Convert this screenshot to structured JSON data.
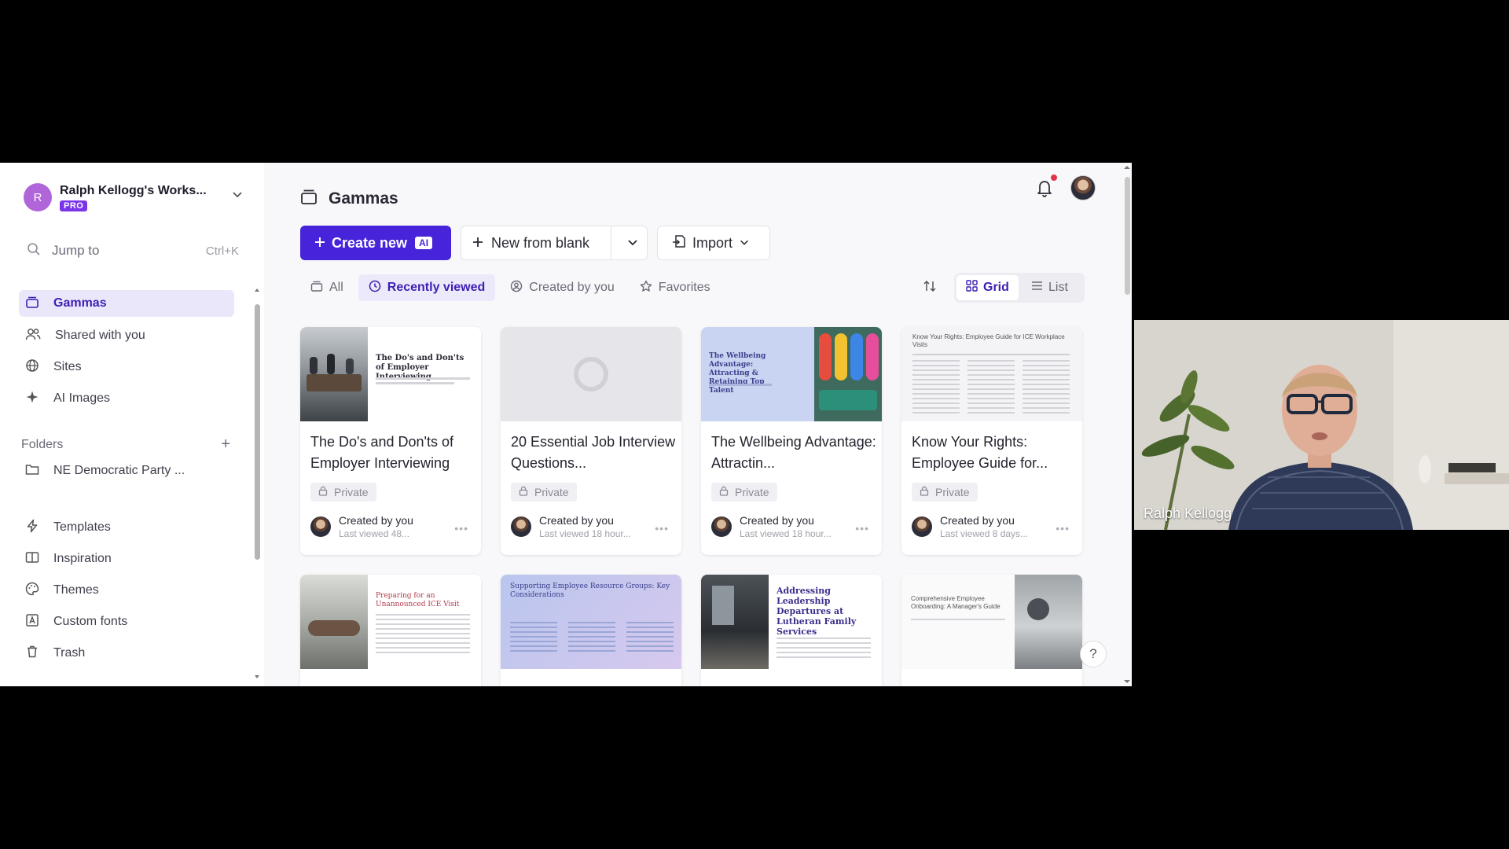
{
  "workspace": {
    "initial": "R",
    "name": "Ralph Kellogg's Works...",
    "badge": "PRO"
  },
  "jump": {
    "label": "Jump to",
    "shortcut": "Ctrl+K"
  },
  "sidebar": {
    "items": [
      {
        "label": "Gammas",
        "icon": "gammas-icon",
        "active": true
      },
      {
        "label": "Shared with you",
        "icon": "shared-users-icon"
      },
      {
        "label": "Sites",
        "icon": "globe-icon"
      },
      {
        "label": "AI Images",
        "icon": "sparkle-icon"
      }
    ],
    "folders_label": "Folders",
    "folders": [
      {
        "label": "NE Democratic Party ...",
        "icon": "folder-icon"
      }
    ],
    "bottom_items": [
      {
        "label": "Templates",
        "icon": "bolt-icon"
      },
      {
        "label": "Inspiration",
        "icon": "book-icon"
      },
      {
        "label": "Themes",
        "icon": "palette-icon"
      },
      {
        "label": "Custom fonts",
        "icon": "font-icon"
      },
      {
        "label": "Trash",
        "icon": "trash-icon"
      }
    ]
  },
  "header": {
    "title": "Gammas"
  },
  "toolbar": {
    "create_label": "Create new",
    "ai_badge": "AI",
    "blank_label": "New from blank",
    "import_label": "Import"
  },
  "filters": [
    {
      "label": "All",
      "icon": "stack-icon"
    },
    {
      "label": "Recently viewed",
      "icon": "clock-icon",
      "active": true
    },
    {
      "label": "Created by you",
      "icon": "user-circle-icon"
    },
    {
      "label": "Favorites",
      "icon": "star-icon"
    }
  ],
  "view": {
    "grid_label": "Grid",
    "list_label": "List",
    "active": "Grid"
  },
  "cards": [
    {
      "title": "The Do's and Don'ts of Employer Interviewing",
      "visibility": "Private",
      "creator": "Created by you",
      "viewed": "Last viewed 48...",
      "thumb_text": "The Do's and Don'ts of Employer Interviewing"
    },
    {
      "title": "20 Essential Job Interview Questions...",
      "visibility": "Private",
      "creator": "Created by you",
      "viewed": "Last viewed 18 hour..."
    },
    {
      "title": "The Wellbeing Advantage: Attractin...",
      "visibility": "Private",
      "creator": "Created by you",
      "viewed": "Last viewed 18 hour...",
      "thumb_text": "The Wellbeing Advantage: Attracting & Retaining Top Talent"
    },
    {
      "title": "Know Your Rights: Employee Guide for...",
      "visibility": "Private",
      "creator": "Created by you",
      "viewed": "Last viewed 8 days...",
      "thumb_text": "Know Your Rights: Employee Guide for ICE Workplace Visits"
    }
  ],
  "cards_row2": [
    {
      "thumb_text": "Preparing for an Unannounced ICE Visit"
    },
    {
      "thumb_text": "Supporting Employee Resource Groups: Key Considerations"
    },
    {
      "thumb_text": "Addressing Leadership Departures at Lutheran Family Services"
    },
    {
      "thumb_text": "Comprehensive Employee Onboarding: A Manager's Guide"
    }
  ],
  "help_label": "?",
  "video": {
    "participant": "Ralph Kellogg"
  },
  "colors": {
    "accent": "#4723d9",
    "active_bg": "#ece9fa",
    "notification": "#e0334c"
  }
}
